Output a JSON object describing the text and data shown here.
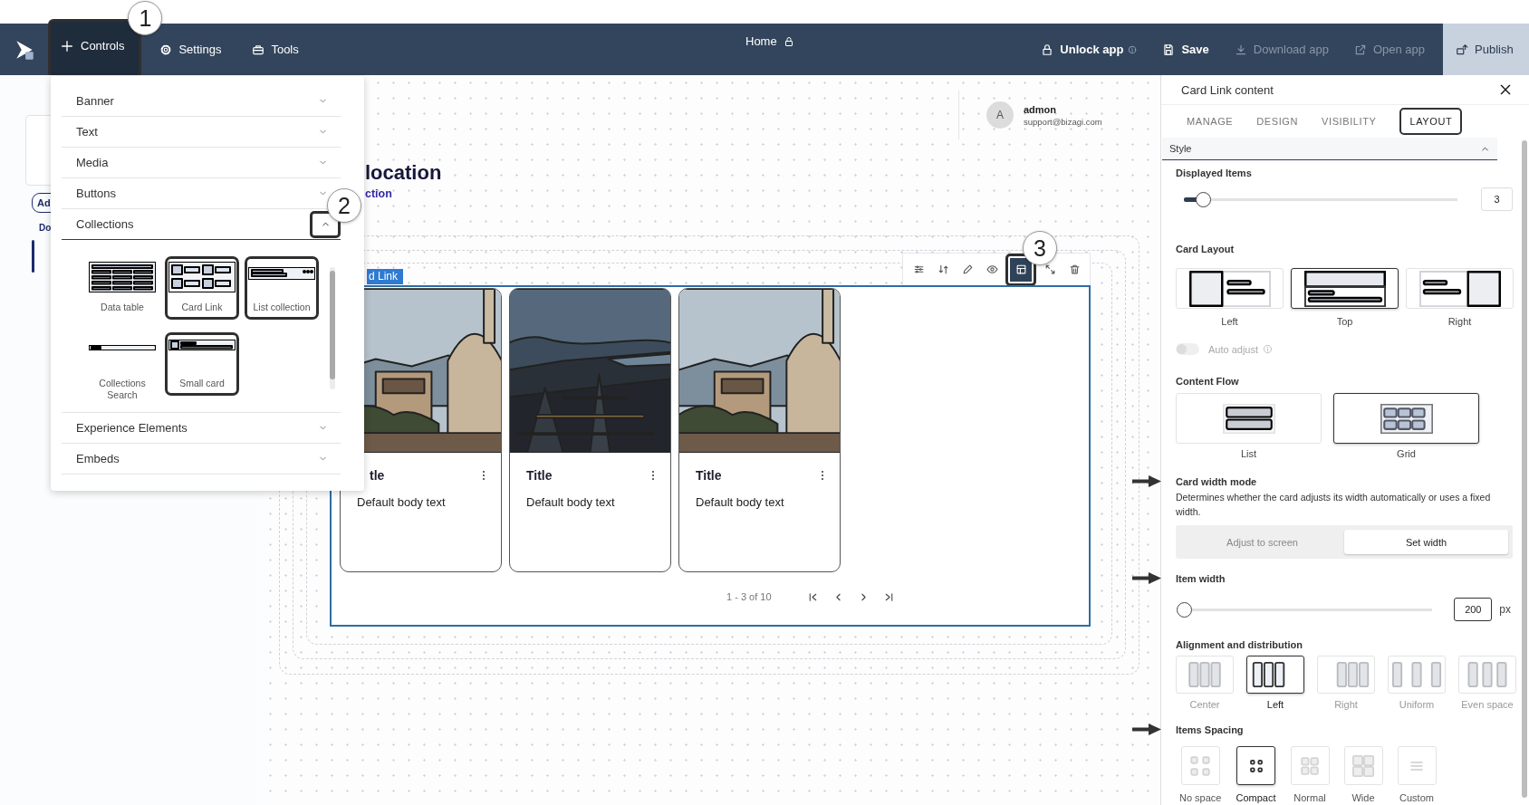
{
  "topbar": {
    "nav": [
      {
        "label": "Controls",
        "selected": true,
        "highlighted": true,
        "callout": "1"
      },
      {
        "label": "Settings",
        "selected": false,
        "highlighted": false
      },
      {
        "label": "Tools",
        "selected": false,
        "highlighted": false
      }
    ],
    "page": {
      "title": "Home",
      "locked": true
    },
    "actions": [
      {
        "label": "Unlock app",
        "kind": "link",
        "disabled": false,
        "info": true
      },
      {
        "label": "Save",
        "kind": "link",
        "disabled": false,
        "info": false
      },
      {
        "label": "Download app",
        "kind": "link",
        "disabled": true,
        "info": false
      },
      {
        "label": "Open app",
        "kind": "link",
        "disabled": true,
        "info": false
      },
      {
        "label": "Publish",
        "kind": "primary",
        "disabled": false,
        "info": false
      }
    ]
  },
  "left_strip": {
    "button": "Ad",
    "label": "Do"
  },
  "controls_menu": {
    "sections": [
      {
        "label": "Banner",
        "expanded": false,
        "highlighted": false
      },
      {
        "label": "Text",
        "expanded": false,
        "highlighted": false
      },
      {
        "label": "Media",
        "expanded": false,
        "highlighted": false
      },
      {
        "label": "Buttons",
        "expanded": false,
        "highlighted": false
      },
      {
        "label": "Collections",
        "expanded": true,
        "highlighted": true,
        "callout": "2",
        "tiles": [
          {
            "label": "Data table",
            "kind": "table",
            "highlighted": false
          },
          {
            "label": "Card Link",
            "kind": "cards",
            "highlighted": true
          },
          {
            "label": "List collection",
            "kind": "list",
            "highlighted": true
          },
          {
            "label": "Collections Search",
            "kind": "search",
            "highlighted": false
          },
          {
            "label": "Small card",
            "kind": "small-card",
            "highlighted": true
          }
        ]
      },
      {
        "label": "Experience Elements",
        "expanded": false,
        "highlighted": false
      },
      {
        "label": "Embeds",
        "expanded": false,
        "highlighted": false
      }
    ]
  },
  "canvas": {
    "user": {
      "initial": "A",
      "name": "admon",
      "email": "support@bizagi.com"
    },
    "heading": "location",
    "subheading": "ction",
    "component": {
      "label": "d Link",
      "toolbar": [
        {
          "selected": false,
          "highlighted": false
        },
        {
          "selected": false,
          "highlighted": false
        },
        {
          "selected": false,
          "highlighted": false
        },
        {
          "selected": false,
          "highlighted": false
        },
        {
          "selected": true,
          "highlighted": true,
          "callout": "3"
        },
        {
          "selected": false,
          "highlighted": false
        },
        {
          "selected": false,
          "highlighted": false
        }
      ],
      "cards": [
        {
          "title": "tle",
          "body": "Default body text",
          "clipped": true
        },
        {
          "title": "Title",
          "body": "Default body text",
          "clipped": false
        },
        {
          "title": "Title",
          "body": "Default body text",
          "clipped": false
        }
      ],
      "pager": {
        "range": "1 - 3 of 10"
      }
    }
  },
  "panel": {
    "title": "Card Link content",
    "tabs": [
      {
        "label": "MANAGE",
        "selected": false
      },
      {
        "label": "DESIGN",
        "selected": false
      },
      {
        "label": "VISIBILITY",
        "selected": false
      },
      {
        "label": "LAYOUT",
        "selected": true
      }
    ],
    "section": {
      "label": "Style",
      "expanded": true
    },
    "groups": [
      {
        "kind": "slider",
        "label": "Displayed Items",
        "level": 0.07,
        "value": "3",
        "arrow": false
      },
      {
        "kind": "layout-options",
        "label": "Card Layout",
        "arrow": false,
        "options": [
          {
            "label": "Left",
            "kind": "image-left",
            "selected": false
          },
          {
            "label": "Top",
            "kind": "image-top",
            "selected": true
          },
          {
            "label": "Right",
            "kind": "image-right",
            "selected": false
          }
        ]
      },
      {
        "kind": "toggle",
        "label": "Auto adjust",
        "on": false,
        "disabled": true,
        "arrow": false
      },
      {
        "kind": "flow-options",
        "label": "Content Flow",
        "arrow": false,
        "options": [
          {
            "label": "List",
            "kind": "list",
            "selected": false
          },
          {
            "label": "Grid",
            "kind": "grid",
            "selected": true
          }
        ]
      },
      {
        "kind": "segmented",
        "label": "Card width mode",
        "description": "Determines whether the card adjusts its width automatically or uses a fixed width.",
        "arrow": true,
        "options": [
          {
            "label": "Adjust to screen",
            "selected": false
          },
          {
            "label": "Set width",
            "selected": true
          }
        ]
      },
      {
        "kind": "slider",
        "label": "Item width",
        "level": 0,
        "value": "200",
        "unit": "px",
        "arrow": true
      },
      {
        "kind": "align-options",
        "label": "Alignment and distribution",
        "arrow": false,
        "options": [
          {
            "label": "Center",
            "kind": "center",
            "selected": false
          },
          {
            "label": "Left",
            "kind": "left",
            "selected": true
          },
          {
            "label": "Right",
            "kind": "right",
            "selected": false
          },
          {
            "label": "Uniform",
            "kind": "uniform",
            "selected": false
          },
          {
            "label": "Even space",
            "kind": "even",
            "selected": false
          }
        ]
      },
      {
        "kind": "spacing-options",
        "label": "Items Spacing",
        "arrow": true,
        "options": [
          {
            "label": "No space",
            "kind": "none",
            "selected": false
          },
          {
            "label": "Compact",
            "kind": "compact",
            "selected": true
          },
          {
            "label": "Normal",
            "kind": "normal",
            "selected": false
          },
          {
            "label": "Wide",
            "kind": "wide",
            "selected": false
          },
          {
            "label": "Custom",
            "kind": "custom",
            "selected": false
          }
        ]
      }
    ]
  }
}
